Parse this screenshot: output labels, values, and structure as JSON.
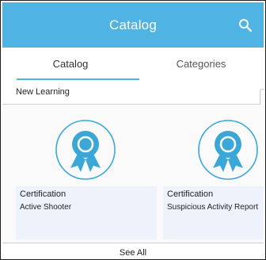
{
  "header": {
    "title": "Catalog",
    "search_icon": "search-icon"
  },
  "tabs": [
    {
      "label": "Catalog",
      "active": true
    },
    {
      "label": "Categories",
      "active": false
    }
  ],
  "section": {
    "title": "New Learning"
  },
  "cards": [
    {
      "type": "Certification",
      "name": "Active Shooter",
      "icon": "certificate-ribbon-icon"
    },
    {
      "type": "Certification",
      "name": "Suspicious Activity Report",
      "icon": "certificate-ribbon-icon"
    }
  ],
  "footer": {
    "see_all": "See All"
  },
  "colors": {
    "accent": "#4fb3e3",
    "card_meta_bg": "#eef3fb",
    "badge_stroke": "#3ba7d6"
  }
}
